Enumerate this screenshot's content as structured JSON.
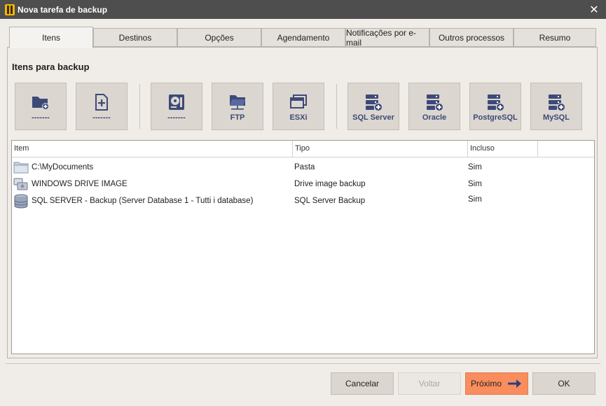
{
  "window": {
    "title": "Nova tarefa de backup"
  },
  "tabs": [
    {
      "label": "Itens",
      "active": true
    },
    {
      "label": "Destinos"
    },
    {
      "label": "Opções"
    },
    {
      "label": "Agendamento"
    },
    {
      "label": "Notificações por e-mail"
    },
    {
      "label": "Outros processos"
    },
    {
      "label": "Resumo"
    }
  ],
  "section": {
    "title": "Itens para backup"
  },
  "toolbar": [
    {
      "label": "-------",
      "icon": "folder-add-icon"
    },
    {
      "label": "-------",
      "icon": "file-add-icon"
    },
    {
      "label": "-------",
      "icon": "drive-image-icon"
    },
    {
      "label": "FTP",
      "icon": "ftp-folder-icon"
    },
    {
      "label": "ESXi",
      "icon": "esxi-window-icon"
    },
    {
      "label": "SQL Server",
      "icon": "database-add-icon"
    },
    {
      "label": "Oracle",
      "icon": "database-add-icon"
    },
    {
      "label": "PostgreSQL",
      "icon": "database-add-icon"
    },
    {
      "label": "MySQL",
      "icon": "database-add-icon"
    }
  ],
  "list": {
    "columns": [
      "Item",
      "Tipo",
      "Incluso"
    ],
    "rows": [
      {
        "item": "C:\\MyDocuments",
        "tipo": "Pasta",
        "incluso": "Sim",
        "icon": "folder-icon"
      },
      {
        "item": "WINDOWS DRIVE IMAGE",
        "tipo": "Drive image backup",
        "incluso": "Sim",
        "icon": "drive-image-icon"
      },
      {
        "item": "SQL SERVER - Backup (Server Database 1 - Tutti i database)",
        "tipo": "SQL Server Backup",
        "incluso": "Sim",
        "icon": "database-icon"
      }
    ]
  },
  "buttons": {
    "cancel": "Cancelar",
    "back": "Voltar",
    "next": "Próximo",
    "ok": "OK"
  },
  "colors": {
    "accent": "#f98d5e",
    "icon": "#3d4a78",
    "titlebar": "#4e4e4e"
  }
}
